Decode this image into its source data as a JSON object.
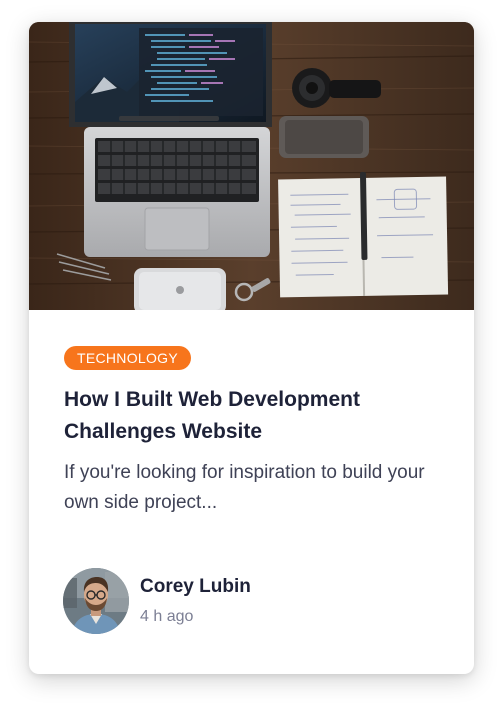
{
  "card": {
    "image": {
      "icon": "laptop-desk-photo",
      "description_colors": {
        "wood": "#4a3426",
        "laptop": "#c8c9cb",
        "screen": "#16222f"
      }
    },
    "category": "TECHNOLOGY",
    "title": "How I Built Web Development Challenges Website",
    "excerpt": "If you're looking for inspiration to build your own side project...",
    "author": {
      "name": "Corey Lubin",
      "time": "4 h ago",
      "avatar_icon": "author-avatar"
    }
  },
  "colors": {
    "accent": "#f7751c",
    "heading": "#1e2238",
    "body_text": "#3f4256",
    "muted": "#7c7f94"
  }
}
